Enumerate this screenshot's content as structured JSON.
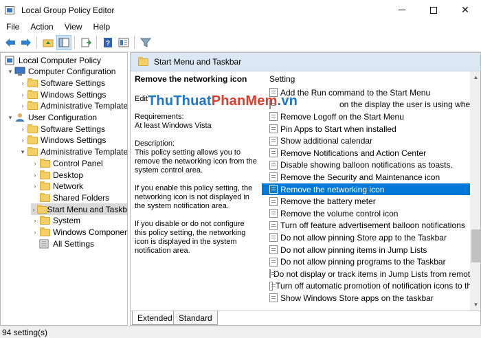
{
  "window": {
    "title": "Local Group Policy Editor"
  },
  "menu": [
    "File",
    "Action",
    "View",
    "Help"
  ],
  "tree": [
    {
      "label": "Local Computer Policy",
      "indent": 0,
      "expander": "",
      "icon": "computer-policy-icon"
    },
    {
      "label": "Computer Configuration",
      "indent": 1,
      "expander": "▾",
      "icon": "computer-icon"
    },
    {
      "label": "Software Settings",
      "indent": 2,
      "expander": "›",
      "icon": "folder-icon"
    },
    {
      "label": "Windows Settings",
      "indent": 2,
      "expander": "›",
      "icon": "folder-icon"
    },
    {
      "label": "Administrative Templates",
      "indent": 2,
      "expander": "›",
      "icon": "folder-icon"
    },
    {
      "label": "User Configuration",
      "indent": 1,
      "expander": "▾",
      "icon": "user-icon"
    },
    {
      "label": "Software Settings",
      "indent": 2,
      "expander": "›",
      "icon": "folder-icon"
    },
    {
      "label": "Windows Settings",
      "indent": 2,
      "expander": "›",
      "icon": "folder-icon"
    },
    {
      "label": "Administrative Templates",
      "indent": 2,
      "expander": "▾",
      "icon": "folder-icon"
    },
    {
      "label": "Control Panel",
      "indent": 3,
      "expander": "›",
      "icon": "folder-icon"
    },
    {
      "label": "Desktop",
      "indent": 3,
      "expander": "›",
      "icon": "folder-icon"
    },
    {
      "label": "Network",
      "indent": 3,
      "expander": "›",
      "icon": "folder-icon"
    },
    {
      "label": "Shared Folders",
      "indent": 3,
      "expander": "",
      "icon": "folder-icon"
    },
    {
      "label": "Start Menu and Taskb",
      "indent": 3,
      "expander": "›",
      "icon": "folder-icon",
      "selected": true
    },
    {
      "label": "System",
      "indent": 3,
      "expander": "›",
      "icon": "folder-icon"
    },
    {
      "label": "Windows Component",
      "indent": 3,
      "expander": "›",
      "icon": "folder-icon"
    },
    {
      "label": "All Settings",
      "indent": 3,
      "expander": "",
      "icon": "all-settings-icon"
    }
  ],
  "detail": {
    "header": "Start Menu and Taskbar",
    "policy_title": "Remove the networking icon",
    "edit_label": "Edit",
    "requirements_label": "Requirements:",
    "requirements_value": "At least Windows Vista",
    "description_label": "Description:",
    "description": "This policy setting allows you to remove the networking icon from the system control area.",
    "enabled_text": "If you enable this policy setting, the networking icon is not displayed in the system notification area.",
    "disabled_text": "If you disable or do not configure this policy setting, the networking icon is displayed in the system notification area."
  },
  "watermark": {
    "part1": "ThuThuat",
    "part2": "PhanMem",
    "part3": ".vn"
  },
  "list": {
    "column": "Setting",
    "items": [
      "Add the Run command to the Start Menu",
      "on the display the user is using when they pr",
      "Remove Logoff on the Start Menu",
      "Pin Apps to Start when installed",
      "Show additional calendar",
      "Remove Notifications and Action Center",
      "Disable showing balloon notifications as toasts.",
      "Remove the Security and Maintenance icon",
      "Remove the networking icon",
      "Remove the battery meter",
      "Remove the volume control icon",
      "Turn off feature advertisement balloon notifications",
      "Do not allow pinning Store app to the Taskbar",
      "Do not allow pinning items in Jump Lists",
      "Do not allow pinning programs to the Taskbar",
      "Do not display or track items in Jump Lists from remote",
      "Turn off automatic promotion of notification icons to th",
      "Show Windows Store apps on the taskbar"
    ],
    "selected_index": 8
  },
  "tabs": [
    "Extended",
    "Standard"
  ],
  "status": "94 setting(s)",
  "colors": {
    "selection": "#0078d7",
    "header": "#dbe8f3",
    "watermark_blue": "#1a76c9",
    "watermark_red": "#e33b2b"
  }
}
